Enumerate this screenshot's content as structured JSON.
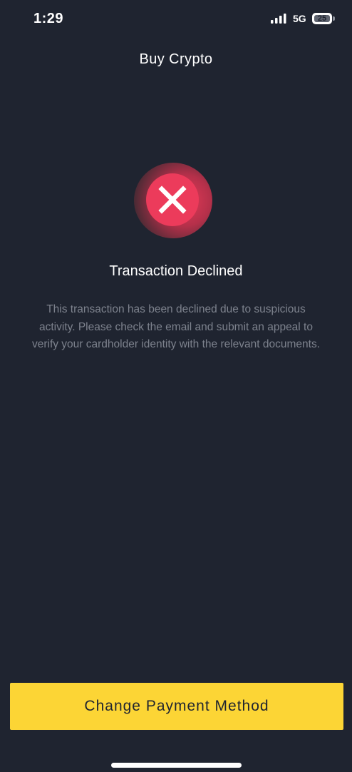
{
  "status_bar": {
    "time": "1:29",
    "network": "5G",
    "battery_level": "25",
    "signal_icon": "cellular-signal-icon",
    "battery_icon": "battery-icon"
  },
  "header": {
    "title": "Buy Crypto"
  },
  "result": {
    "icon": "error-x-icon",
    "icon_color": "#ec3b5b",
    "title": "Transaction Declined",
    "message": "This transaction has been declined due to suspicious activity. Please check the email and submit an appeal to verify your cardholder identity with the relevant documents."
  },
  "actions": {
    "primary_label": "Change Payment Method",
    "primary_color": "#fcd535"
  },
  "theme": {
    "background": "#1f2430",
    "muted_text": "#7d828d"
  }
}
